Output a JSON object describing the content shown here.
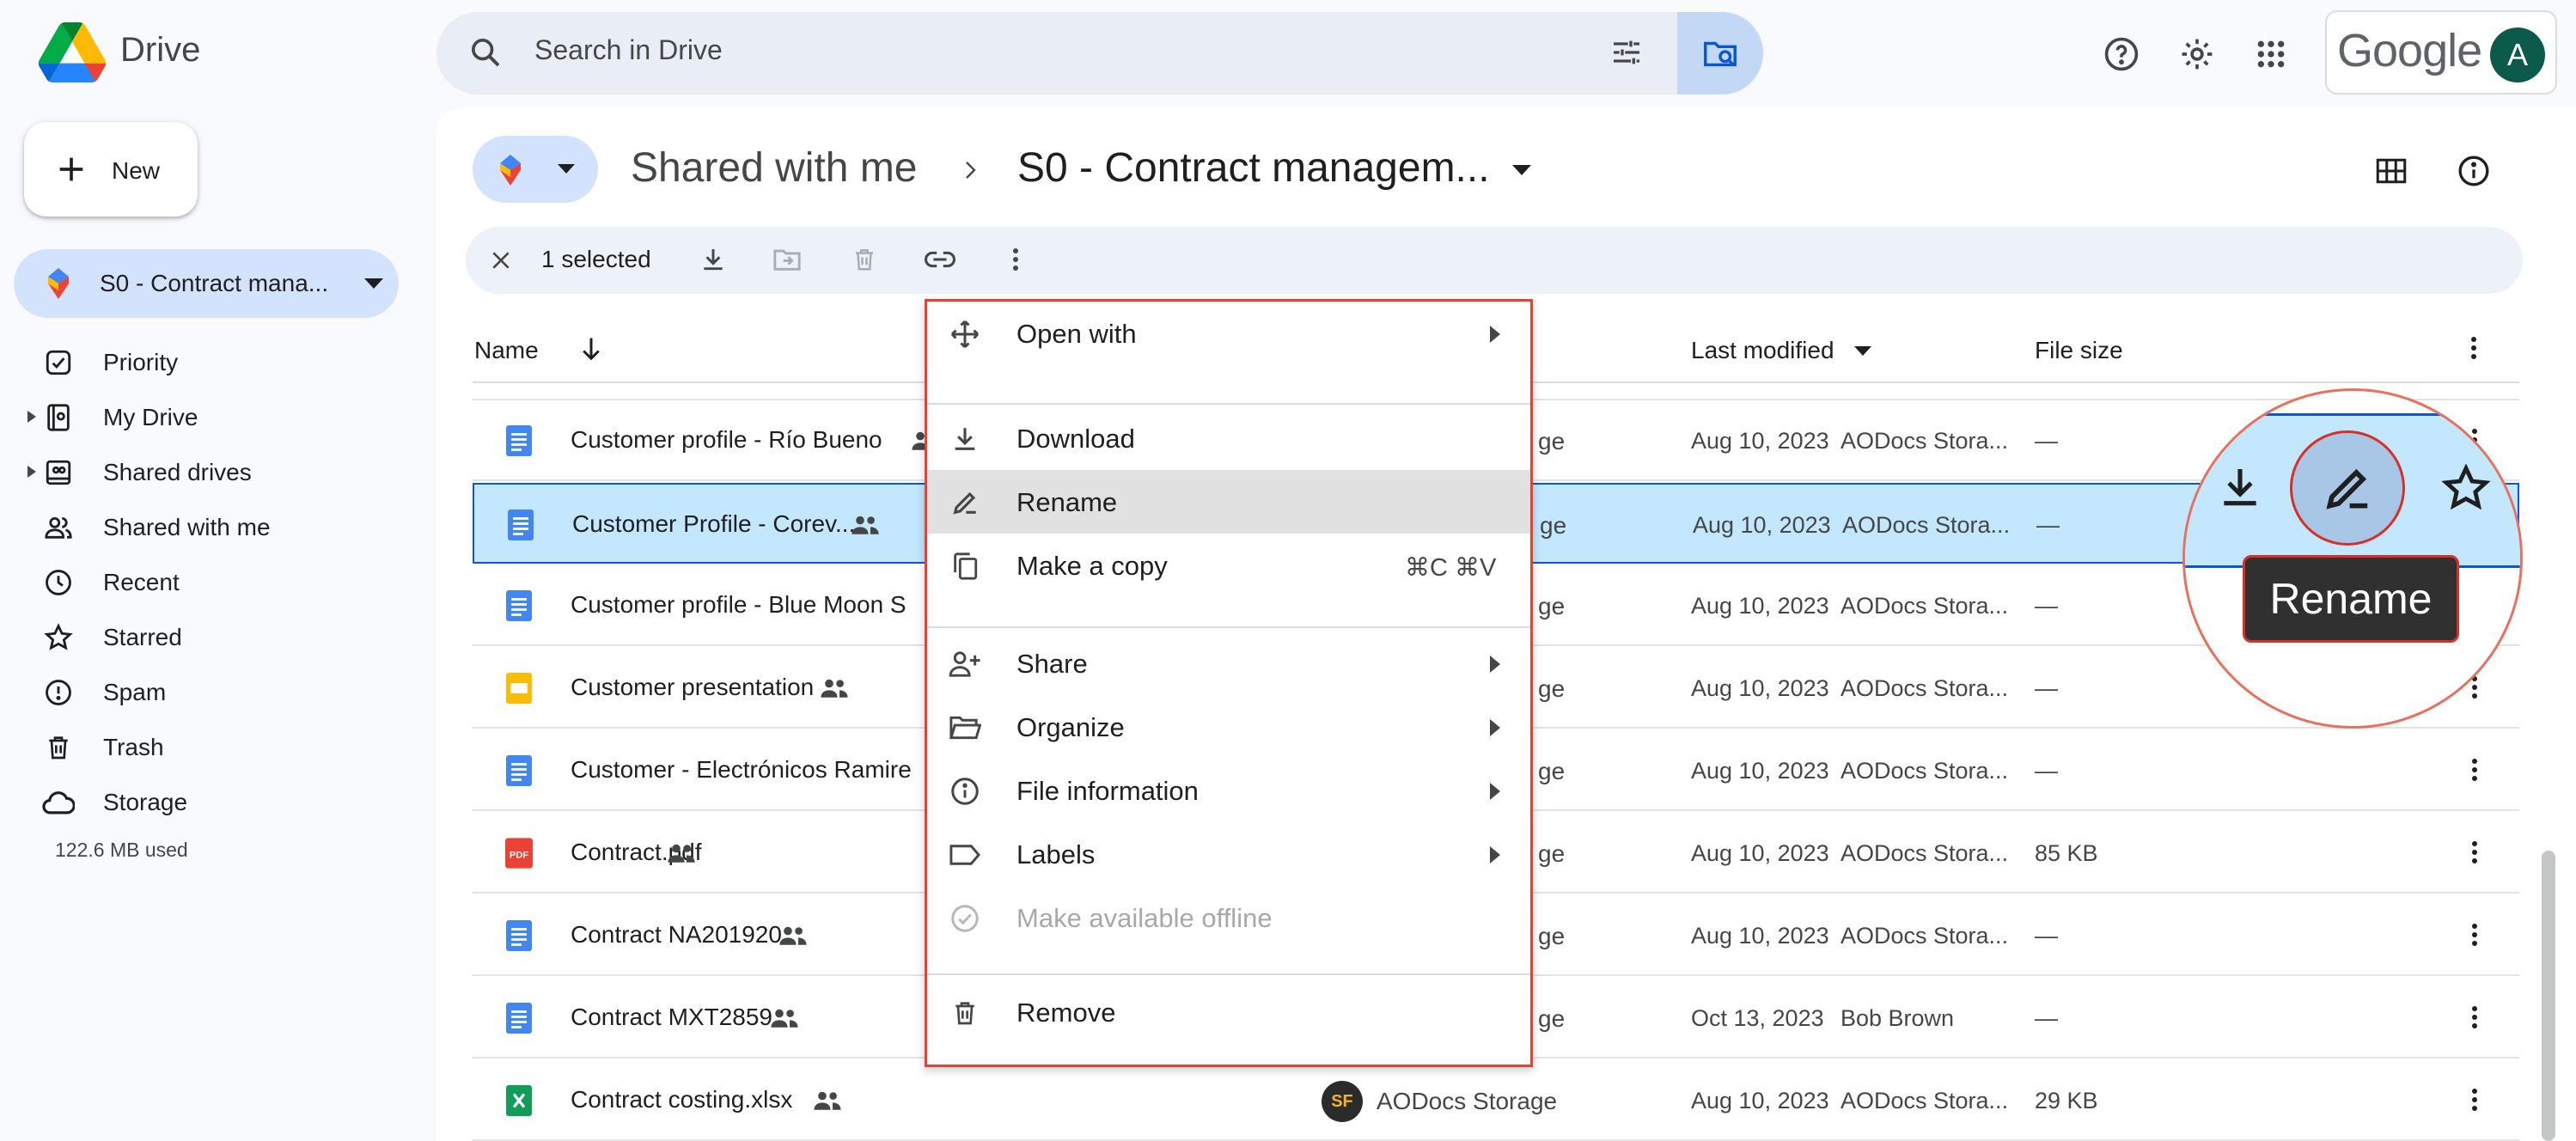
{
  "app": {
    "title": "Drive",
    "brand": "Google",
    "avatar_letter": "A"
  },
  "search": {
    "placeholder": "Search in Drive"
  },
  "sidebar": {
    "new_label": "New",
    "shared_drive_label": "S0 - Contract mana...",
    "items": [
      {
        "label": "Priority",
        "icon": "priority-icon"
      },
      {
        "label": "My Drive",
        "icon": "my-drive-icon"
      },
      {
        "label": "Shared drives",
        "icon": "shared-drives-icon"
      },
      {
        "label": "Shared with me",
        "icon": "shared-with-me-icon"
      },
      {
        "label": "Recent",
        "icon": "recent-icon"
      },
      {
        "label": "Starred",
        "icon": "star-icon"
      },
      {
        "label": "Spam",
        "icon": "spam-icon"
      },
      {
        "label": "Trash",
        "icon": "trash-icon"
      },
      {
        "label": "Storage",
        "icon": "cloud-icon"
      }
    ],
    "storage_used": "122.6 MB used"
  },
  "breadcrumb": {
    "parent": "Shared with me",
    "current": "S0 - Contract managem..."
  },
  "selection": {
    "count_label": "1 selected"
  },
  "columns": {
    "name": "Name",
    "modified": "Last modified",
    "size": "File size"
  },
  "files": [
    {
      "name": "Customer profile - Río Bueno",
      "type": "doc",
      "shared": true,
      "owner": "ge",
      "date": "Aug 10, 2023",
      "by": "AODocs Stora...",
      "size": "—"
    },
    {
      "name": "Customer Profile - Corev...",
      "type": "doc",
      "shared": true,
      "owner": "ge",
      "date": "Aug 10, 2023",
      "by": "AODocs Stora...",
      "size": "—",
      "selected": true
    },
    {
      "name": "Customer profile - Blue Moon S",
      "type": "doc",
      "shared": false,
      "owner": "ge",
      "date": "Aug 10, 2023",
      "by": "AODocs Stora...",
      "size": "—"
    },
    {
      "name": "Customer presentation",
      "type": "slides",
      "shared": true,
      "owner": "ge",
      "date": "Aug 10, 2023",
      "by": "AODocs Stora...",
      "size": "—"
    },
    {
      "name": "Customer - Electrónicos Ramire",
      "type": "doc",
      "shared": false,
      "owner": "ge",
      "date": "Aug 10, 2023",
      "by": "AODocs Stora...",
      "size": "—"
    },
    {
      "name": "Contract.pdf",
      "type": "pdf",
      "shared": true,
      "owner": "ge",
      "date": "Aug 10, 2023",
      "by": "AODocs Stora...",
      "size": "85 KB"
    },
    {
      "name": "Contract NA201920",
      "type": "doc",
      "shared": true,
      "owner": "ge",
      "date": "Aug 10, 2023",
      "by": "AODocs Stora...",
      "size": "—"
    },
    {
      "name": "Contract MXT2859",
      "type": "doc",
      "shared": true,
      "owner": "ge",
      "date": "Oct 13, 2023",
      "by": "Bob Brown",
      "size": "—"
    },
    {
      "name": "Contract costing.xlsx",
      "type": "sheet",
      "shared": true,
      "owner": "AODocs Storage",
      "date": "Aug 10, 2023",
      "by": "AODocs Stora...",
      "size": "29 KB"
    }
  ],
  "context_menu": {
    "open_with": "Open with",
    "download": "Download",
    "rename": "Rename",
    "make_copy": "Make a copy",
    "make_copy_shortcut": "⌘C ⌘V",
    "share": "Share",
    "organize": "Organize",
    "file_information": "File information",
    "labels": "Labels",
    "make_offline": "Make available offline",
    "remove": "Remove"
  },
  "zoom_callout": {
    "tooltip": "Rename"
  },
  "owner_avatar_text": "SF",
  "colors": {
    "accent": "#0b57d0",
    "selected_row": "#c2e7ff",
    "highlight_border": "#e8412f"
  }
}
